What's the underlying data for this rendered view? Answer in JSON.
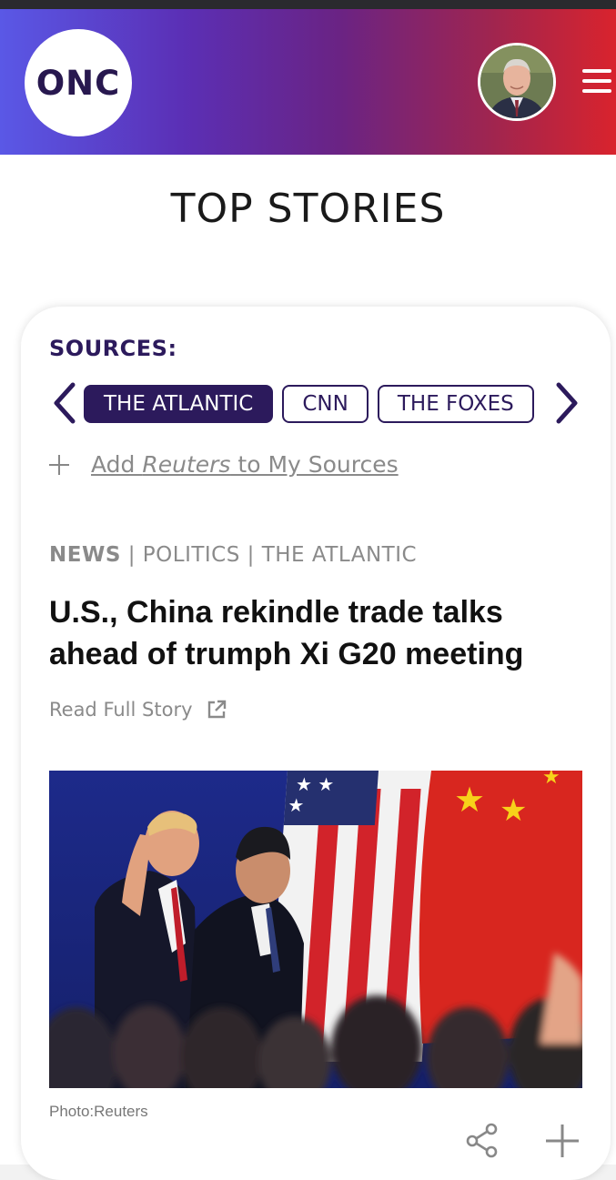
{
  "header": {
    "logo_text": "ONC",
    "avatar": "user-avatar",
    "menu_icon": "hamburger-menu-icon"
  },
  "page_title": "TOP STORIES",
  "sources": {
    "label": "SOURCES:",
    "chips": [
      {
        "label": "THE ATLANTIC",
        "active": true
      },
      {
        "label": "CNN",
        "active": false
      },
      {
        "label": "THE FOXES",
        "active": false
      }
    ],
    "add_prefix": "Add ",
    "add_source_name": "Reuters",
    "add_suffix": " to My Sources"
  },
  "story": {
    "category_primary": "NEWS",
    "category_rest": " | POLITICS | THE ATLANTIC",
    "headline": "U.S., China rekindle trade talks ahead of trumph Xi G20 meeting",
    "read_full": "Read Full Story",
    "photo_caption": "Photo:Reuters"
  },
  "colors": {
    "brand_dark": "#2c1a5c",
    "gradient_start": "#5a58e6",
    "gradient_end": "#d9232d"
  }
}
